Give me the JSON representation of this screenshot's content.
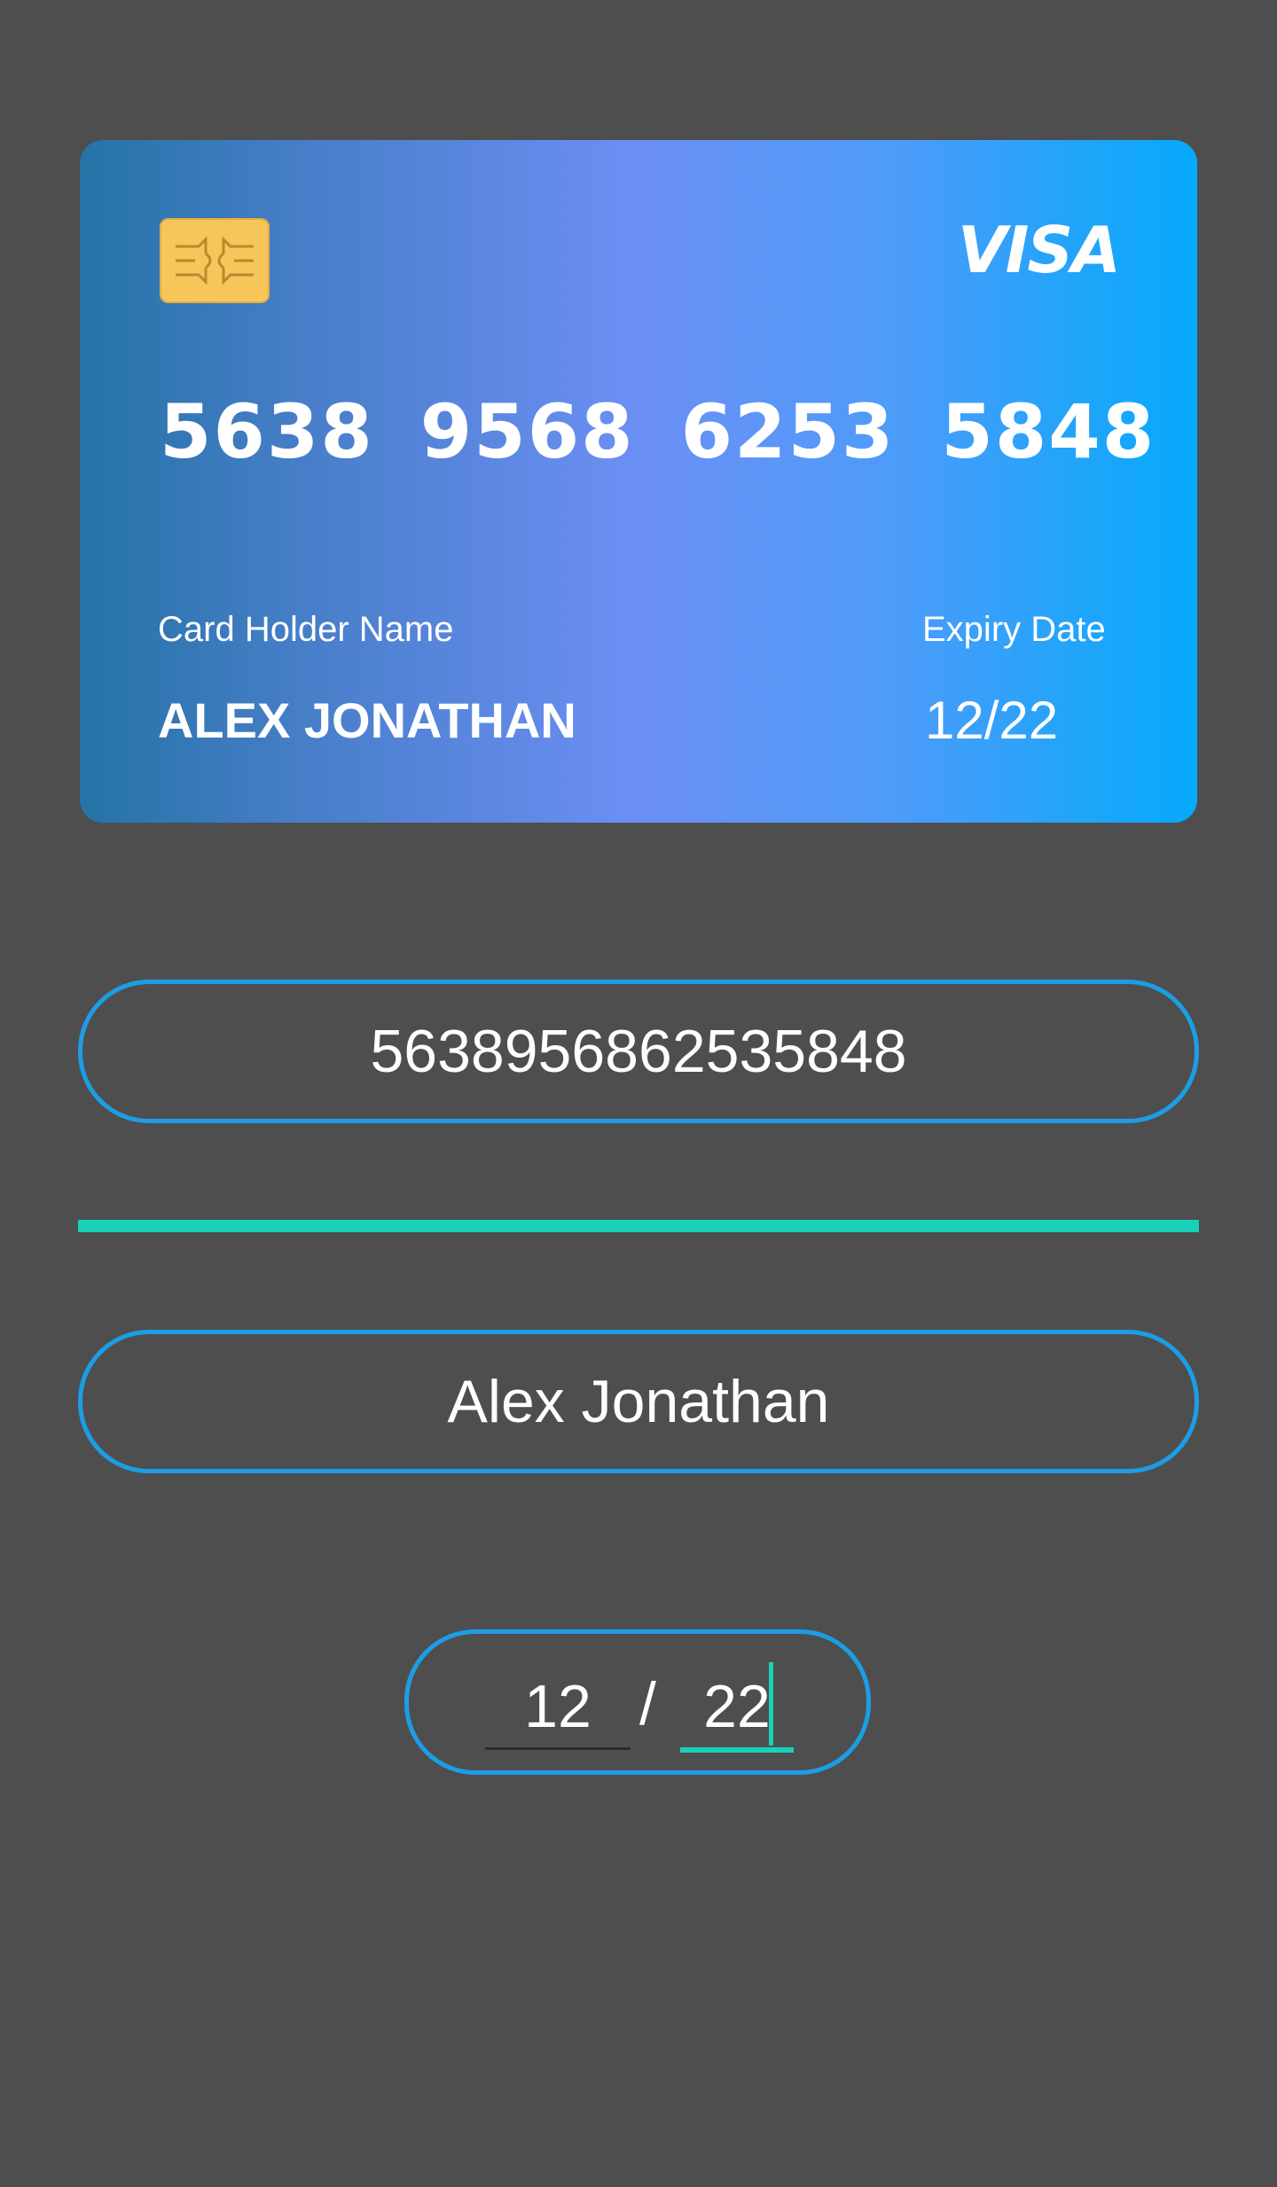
{
  "card": {
    "brand": "VISA",
    "number_groups": [
      "5638",
      "9568",
      "6253",
      "5848"
    ],
    "holder_label": "Card Holder Name",
    "holder_name": "ALEX JONATHAN",
    "expiry_label": "Expiry Date",
    "expiry_value": "12/22",
    "gradient_colors": [
      "#2573a7",
      "#6c8ff5",
      "#05aafb"
    ],
    "chip_color": "#f6c65b"
  },
  "form": {
    "card_number_value": "5638956862535848",
    "holder_name_value": "Alex Jonathan",
    "expiry_month_value": "12",
    "expiry_separator": "/",
    "expiry_year_value": "22"
  },
  "colors": {
    "background": "#4e4e4e",
    "input_border": "#1b9ee5",
    "accent": "#19d1b8"
  }
}
